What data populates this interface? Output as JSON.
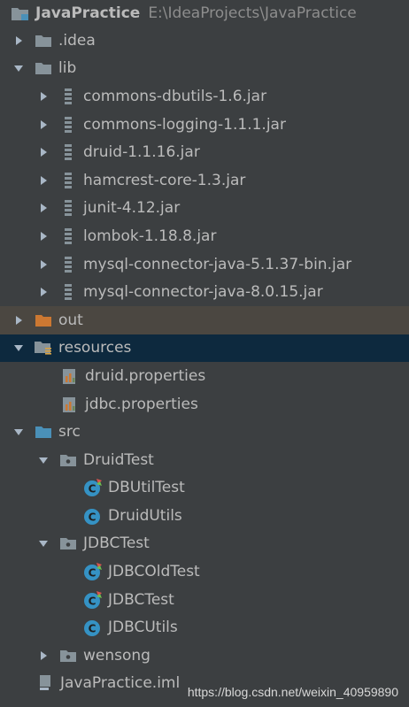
{
  "project": {
    "name": "JavaPractice",
    "path": "E:\\IdeaProjects\\JavaPractice"
  },
  "nodes": {
    "idea": ".idea",
    "lib": "lib",
    "jars": [
      "commons-dbutils-1.6.jar",
      "commons-logging-1.1.1.jar",
      "druid-1.1.16.jar",
      "hamcrest-core-1.3.jar",
      "junit-4.12.jar",
      "lombok-1.18.8.jar",
      "mysql-connector-java-5.1.37-bin.jar",
      "mysql-connector-java-8.0.15.jar"
    ],
    "out": "out",
    "resources": "resources",
    "resource_files": [
      "druid.properties",
      "jdbc.properties"
    ],
    "src": "src",
    "druid_pkg": "DruidTest",
    "druid_classes": [
      "DBUtilTest",
      "DruidUtils"
    ],
    "jdbc_pkg": "JDBCTest",
    "jdbc_classes": [
      "JDBCOldTest",
      "JDBCTest",
      "JDBCUtils"
    ],
    "wensong_pkg": "wensong",
    "iml": "JavaPractice.iml"
  },
  "watermark": "https://blog.csdn.net/weixin_40959890",
  "colors": {
    "background": "#3c3f41",
    "selected_row": "#0d293e",
    "excluded_row": "#4b4741",
    "folder": "#87939a",
    "source_folder": "#4a90b8",
    "excluded_folder": "#cc7832",
    "class_icon": "#3592c4"
  },
  "icons": {
    "folder": "folder-icon",
    "jar": "jar-icon",
    "properties": "properties-file-icon",
    "class": "java-class-icon",
    "package": "package-icon",
    "module": "module-icon",
    "iml": "iml-file-icon"
  }
}
